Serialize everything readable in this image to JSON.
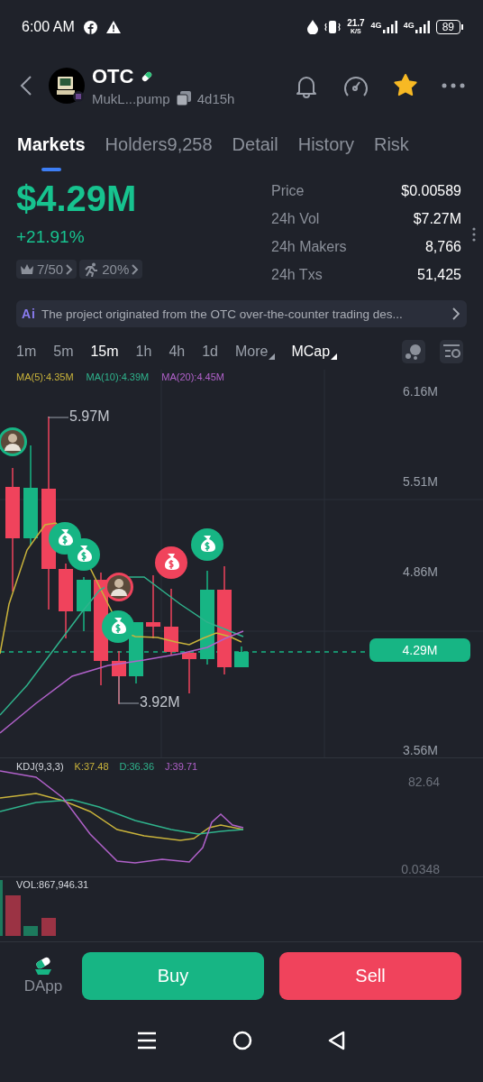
{
  "status_bar": {
    "time": "6:00 AM",
    "speed": "21.7",
    "speed_unit": "K/S",
    "networks": [
      "4G",
      "4G"
    ],
    "battery": "89"
  },
  "header": {
    "title": "OTC",
    "address": "MukL...pump",
    "age": "4d15h",
    "starred": true
  },
  "tabs": [
    {
      "label": "Markets",
      "selected": true
    },
    {
      "label": "Holders9,258",
      "selected": false
    },
    {
      "label": "Detail",
      "selected": false
    },
    {
      "label": "History",
      "selected": false
    },
    {
      "label": "Risk",
      "selected": false
    }
  ],
  "summary": {
    "market_cap": "$4.29M",
    "change": "+21.91%",
    "badges": [
      "7/50",
      "20%"
    ]
  },
  "stats": [
    {
      "label": "Price",
      "value": "$0.00589"
    },
    {
      "label": "24h Vol",
      "value": "$7.27M"
    },
    {
      "label": "24h Makers",
      "value": "8,766"
    },
    {
      "label": "24h Txs",
      "value": "51,425"
    }
  ],
  "ai_banner": {
    "badge": "Ai",
    "text": "The project originated from the OTC over-the-counter trading des..."
  },
  "intervals": [
    {
      "label": "1m",
      "selected": false
    },
    {
      "label": "5m",
      "selected": false
    },
    {
      "label": "15m",
      "selected": true
    },
    {
      "label": "1h",
      "selected": false
    },
    {
      "label": "4h",
      "selected": false
    },
    {
      "label": "1d",
      "selected": false
    }
  ],
  "dropdowns": [
    {
      "label": "More",
      "active": false
    },
    {
      "label": "MCap",
      "active": true
    }
  ],
  "chart": {
    "moving_averages": [
      {
        "label": "MA(5):4.35M",
        "color": "#c9b33b"
      },
      {
        "label": "MA(10):4.39M",
        "color": "#2fb38c"
      },
      {
        "label": "MA(20):4.45M",
        "color": "#b061c9"
      }
    ],
    "axis_labels": [
      "6.16M",
      "5.51M",
      "4.86M",
      "3.56M"
    ],
    "high_label": "5.97M",
    "low_label": "3.92M",
    "current": "4.29M"
  },
  "kdj": {
    "title": "KDJ(9,3,3)",
    "values": [
      {
        "label": "K:37.48",
        "color": "#c9b33b"
      },
      {
        "label": "D:36.36",
        "color": "#2fb38c"
      },
      {
        "label": "J:39.71",
        "color": "#b061c9"
      }
    ],
    "axis_labels": [
      "82.64",
      "0.0348"
    ]
  },
  "volume": {
    "label": "VOL:867,946.31"
  },
  "actions": {
    "dapp": "DApp",
    "buy": "Buy",
    "sell": "Sell"
  }
}
